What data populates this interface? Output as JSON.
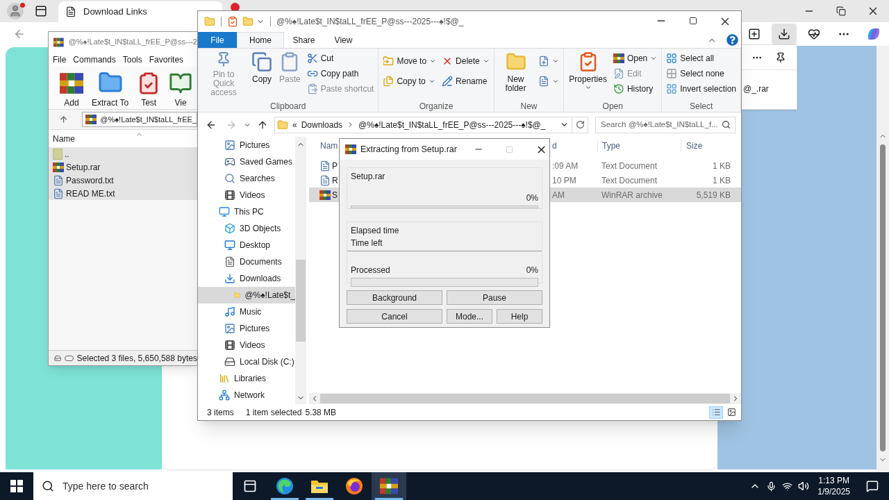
{
  "browser": {
    "tabs": [
      {
        "label": "Download Links",
        "selected": true
      }
    ],
    "download_panel": {
      "file": "@_.rar"
    }
  },
  "winrar": {
    "title": "@%♠!Late$t_IN$taLL_frEE_P@ss---2",
    "menu": [
      "File",
      "Commands",
      "Tools",
      "Favorites"
    ],
    "toolbar": [
      {
        "label": "Add",
        "kind": "add"
      },
      {
        "label": "Extract To",
        "kind": "extract"
      },
      {
        "label": "Test",
        "kind": "test"
      },
      {
        "label": "Vie",
        "kind": "view"
      }
    ],
    "address": "@%♠!Late$t_IN$taLL_frEE_",
    "column": "Name",
    "files": [
      {
        "name": "..",
        "kind": "parent",
        "selected": true
      },
      {
        "name": "Setup.rar",
        "kind": "archive",
        "selected": true
      },
      {
        "name": "Password.txt",
        "kind": "text",
        "selected": true
      },
      {
        "name": "READ ME.txt",
        "kind": "text",
        "selected": true
      }
    ],
    "status": "Selected 3 files, 5,650,588 bytes"
  },
  "explorer": {
    "title": "@%♠!Late$t_IN$taLL_frEE_P@ss---2025---♠!$@_",
    "tabs": [
      {
        "label": "File",
        "kind": "file",
        "selected": false
      },
      {
        "label": "Home",
        "kind": "tab",
        "selected": true
      },
      {
        "label": "Share",
        "kind": "tab",
        "selected": false
      },
      {
        "label": "View",
        "kind": "tab",
        "selected": false
      }
    ],
    "groups": [
      {
        "label": "Clipboard",
        "columns": [
          {
            "kind": "large",
            "items": [
              {
                "label": "Pin to Quick access",
                "kind": "pin",
                "disabled": true
              }
            ]
          },
          {
            "kind": "large",
            "items": [
              {
                "label": "Copy",
                "kind": "copy",
                "disabled": false
              }
            ]
          },
          {
            "kind": "large",
            "items": [
              {
                "label": "Paste",
                "kind": "paste",
                "disabled": true
              }
            ]
          },
          {
            "kind": "small",
            "items": [
              {
                "label": "Cut",
                "kind": "cut",
                "disabled": false
              },
              {
                "label": "Copy path",
                "kind": "copypath",
                "disabled": false
              },
              {
                "label": "Paste shortcut",
                "kind": "pasteshortcut",
                "disabled": true
              }
            ]
          }
        ]
      },
      {
        "label": "Organize",
        "columns": [
          {
            "kind": "small",
            "items": [
              {
                "label": "Move to",
                "kind": "move",
                "disabled": false,
                "dropdown": true
              },
              {
                "label": "Copy to",
                "kind": "copyto",
                "disabled": false,
                "dropdown": true
              }
            ]
          },
          {
            "kind": "small",
            "items": [
              {
                "label": "Delete",
                "kind": "delete",
                "disabled": false,
                "dropdown": true
              },
              {
                "label": "Rename",
                "kind": "rename",
                "disabled": false
              }
            ]
          }
        ]
      },
      {
        "label": "New",
        "columns": [
          {
            "kind": "large",
            "items": [
              {
                "label": "New folder",
                "kind": "newfolder",
                "disabled": false
              }
            ]
          },
          {
            "kind": "small",
            "items": [
              {
                "kind": "newitem",
                "disabled": false,
                "dropdown": true
              },
              {
                "kind": "easyaccess",
                "disabled": false,
                "dropdown": true
              }
            ]
          }
        ]
      },
      {
        "label": "Open",
        "columns": [
          {
            "kind": "large",
            "items": [
              {
                "label": "Properties",
                "kind": "properties",
                "disabled": false,
                "dropdown": true
              }
            ]
          },
          {
            "kind": "small",
            "items": [
              {
                "label": "Open",
                "kind": "open",
                "disabled": false,
                "dropdown": true
              },
              {
                "label": "Edit",
                "kind": "edit",
                "disabled": true
              },
              {
                "label": "History",
                "kind": "history",
                "disabled": false
              }
            ]
          }
        ]
      },
      {
        "label": "Select",
        "columns": [
          {
            "kind": "small",
            "items": [
              {
                "label": "Select all",
                "kind": "selectall",
                "disabled": false
              },
              {
                "label": "Select none",
                "kind": "selectnone",
                "disabled": false
              },
              {
                "label": "Invert selection",
                "kind": "invert",
                "disabled": false
              }
            ]
          }
        ]
      }
    ],
    "breadcrumb": {
      "overflow": "«",
      "items": [
        "Downloads",
        "@%♠!Late$t_IN$taLL_frEE_P@ss---2025---♠!$@_"
      ]
    },
    "search": {
      "placeholder": "Search @%♠!Late$t_IN$taLL_f..."
    },
    "nav_above": [
      {
        "label": "Pictures",
        "kind": "pictures",
        "selected": false
      },
      {
        "label": "Saved Games",
        "kind": "games",
        "selected": false
      },
      {
        "label": "Searches",
        "kind": "searches",
        "selected": false
      },
      {
        "label": "Videos",
        "kind": "videos",
        "selected": false
      }
    ],
    "nav": [
      {
        "label": "This PC",
        "kind": "pc",
        "selected": false,
        "children": [
          {
            "label": "3D Objects",
            "kind": "objects",
            "selected": false
          },
          {
            "label": "Desktop",
            "kind": "desktop",
            "selected": false
          },
          {
            "label": "Documents",
            "kind": "documents",
            "selected": false
          },
          {
            "label": "Downloads",
            "kind": "downloads",
            "selected": false,
            "children": [
              {
                "label": "@%♠!Late$t_",
                "kind": "folder",
                "selected": true
              }
            ]
          },
          {
            "label": "Music",
            "kind": "music",
            "selected": false
          },
          {
            "label": "Pictures",
            "kind": "pictures",
            "selected": false
          },
          {
            "label": "Videos",
            "kind": "videos",
            "selected": false
          },
          {
            "label": "Local Disk (C:)",
            "kind": "disk",
            "selected": false
          }
        ]
      },
      {
        "label": "Libraries",
        "kind": "libraries",
        "selected": false
      },
      {
        "label": "Network",
        "kind": "network",
        "selected": false
      }
    ],
    "columns": [
      "Nam",
      "d",
      "Type",
      "Size"
    ],
    "rows": [
      {
        "name": "P",
        "date": ":09 AM",
        "type": "Text Document",
        "size": "1 KB",
        "kind": "text",
        "selected": false
      },
      {
        "name": "R",
        "date": "10 PM",
        "type": "Text Document",
        "size": "1 KB",
        "kind": "text",
        "selected": false
      },
      {
        "name": "S",
        "date": "AM",
        "type": "WinRAR archive",
        "size": "5,519 KB",
        "kind": "archive",
        "selected": true
      }
    ],
    "status": [
      "3 items",
      "1 item selected",
      "5.38 MB"
    ],
    "views": [
      {
        "kind": "details",
        "selected": true
      },
      {
        "kind": "icons",
        "selected": false
      }
    ]
  },
  "dialog": {
    "title": "Extracting from Setup.rar",
    "maximize_disabled": true,
    "file": "Setup.rar",
    "file_percent": "0%",
    "file_progress": {
      "level": 0
    },
    "elapsed": "Elapsed time",
    "left": "Time left",
    "processed": "Processed",
    "total_percent": "0%",
    "total_progress": {
      "level": 0
    },
    "buttons": [
      "Background",
      "Pause",
      "Cancel",
      "Mode...",
      "Help"
    ]
  },
  "taskbar": {
    "search": {
      "placeholder": "Type here to search"
    },
    "apps": [
      {
        "kind": "taskview",
        "running": false,
        "selected": false
      },
      {
        "kind": "edge",
        "running": true,
        "selected": false
      },
      {
        "kind": "explorer",
        "running": true,
        "selected": false
      },
      {
        "kind": "firefox",
        "running": false,
        "selected": false
      },
      {
        "kind": "winrar",
        "running": true,
        "selected": true
      }
    ],
    "time": "1:13 PM",
    "date": "1/9/2025"
  }
}
